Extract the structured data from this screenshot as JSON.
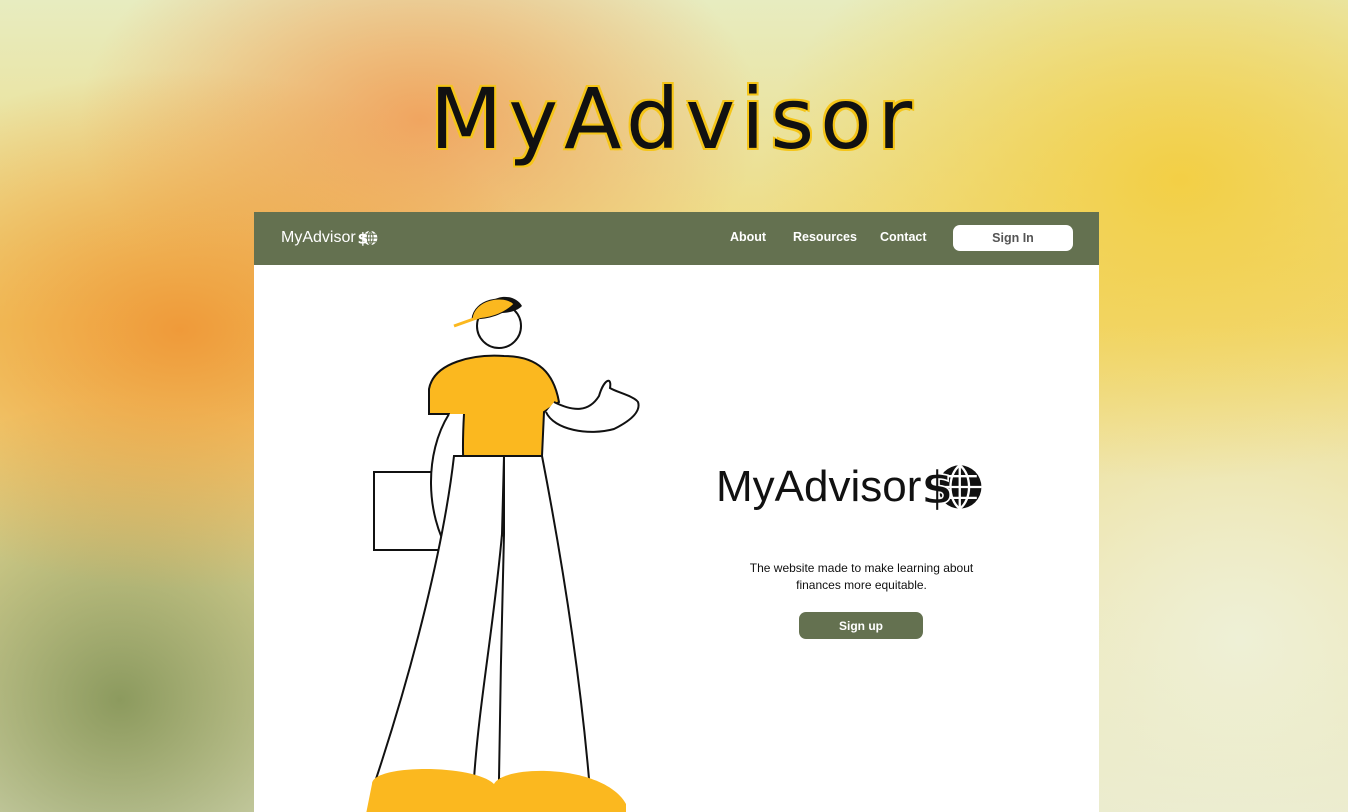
{
  "hero": {
    "title": "MyAdvisor"
  },
  "nav": {
    "brand": "MyAdvisor",
    "links": [
      "About",
      "Resources",
      "Contact"
    ],
    "signin_label": "Sign In"
  },
  "main": {
    "logo_text": "MyAdvisor",
    "tagline_line1": "The website made to make learning about",
    "tagline_line2": "finances more equitable.",
    "signup_label": "Sign up"
  },
  "colors": {
    "nav_bg": "#647150",
    "accent_yellow": "#fbb81f",
    "button_bg": "#647150"
  },
  "icons": [
    "dollar-globe-icon",
    "person-illustration"
  ]
}
